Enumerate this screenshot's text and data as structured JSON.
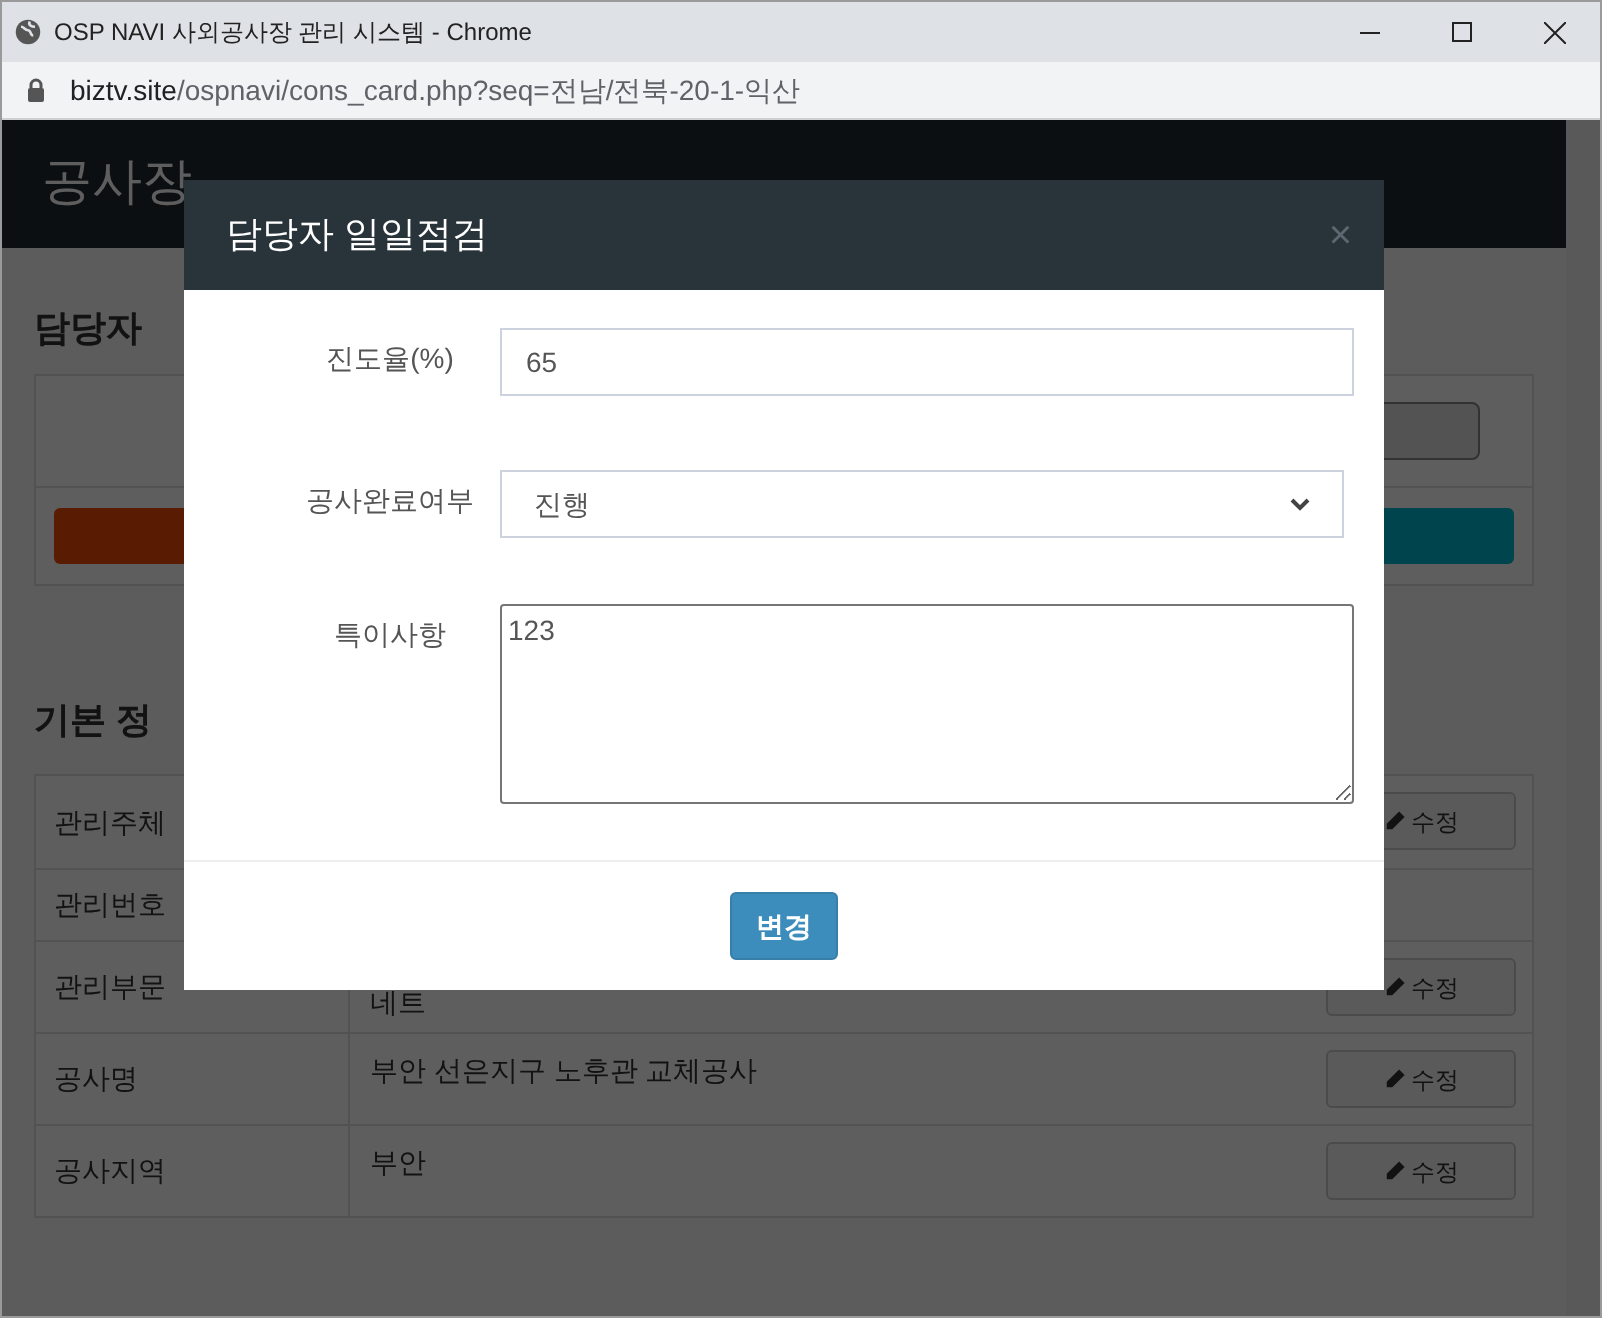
{
  "browser": {
    "title": "OSP NAVI 사외공사장 관리 시스템 - Chrome",
    "url_host": "biztv.site",
    "url_path": "/ospnavi/cons_card.php?seq=전남/전북-20-1-익산"
  },
  "page": {
    "header": "공사장",
    "section_1_title": "담당자",
    "section_2_title": "기본 정",
    "rows": [
      {
        "label": "관리주체",
        "edit": "수정"
      },
      {
        "label": "관리번호"
      },
      {
        "label": "관리부문",
        "value": "네트",
        "edit": "수정"
      },
      {
        "label": "공사명",
        "value": "부안 선은지구 노후관 교체공사",
        "edit": "수정"
      },
      {
        "label": "공사지역",
        "value": "부안",
        "edit": "수정"
      }
    ]
  },
  "modal": {
    "title": "담당자 일일점검",
    "close": "×",
    "fields": [
      {
        "label": "진도율(%)",
        "kind": "input",
        "value": "65"
      },
      {
        "label": "공사완료여부",
        "kind": "select",
        "value": "진행"
      },
      {
        "label": "특이사항",
        "kind": "textarea",
        "value": "123"
      }
    ],
    "submit": "변경"
  }
}
